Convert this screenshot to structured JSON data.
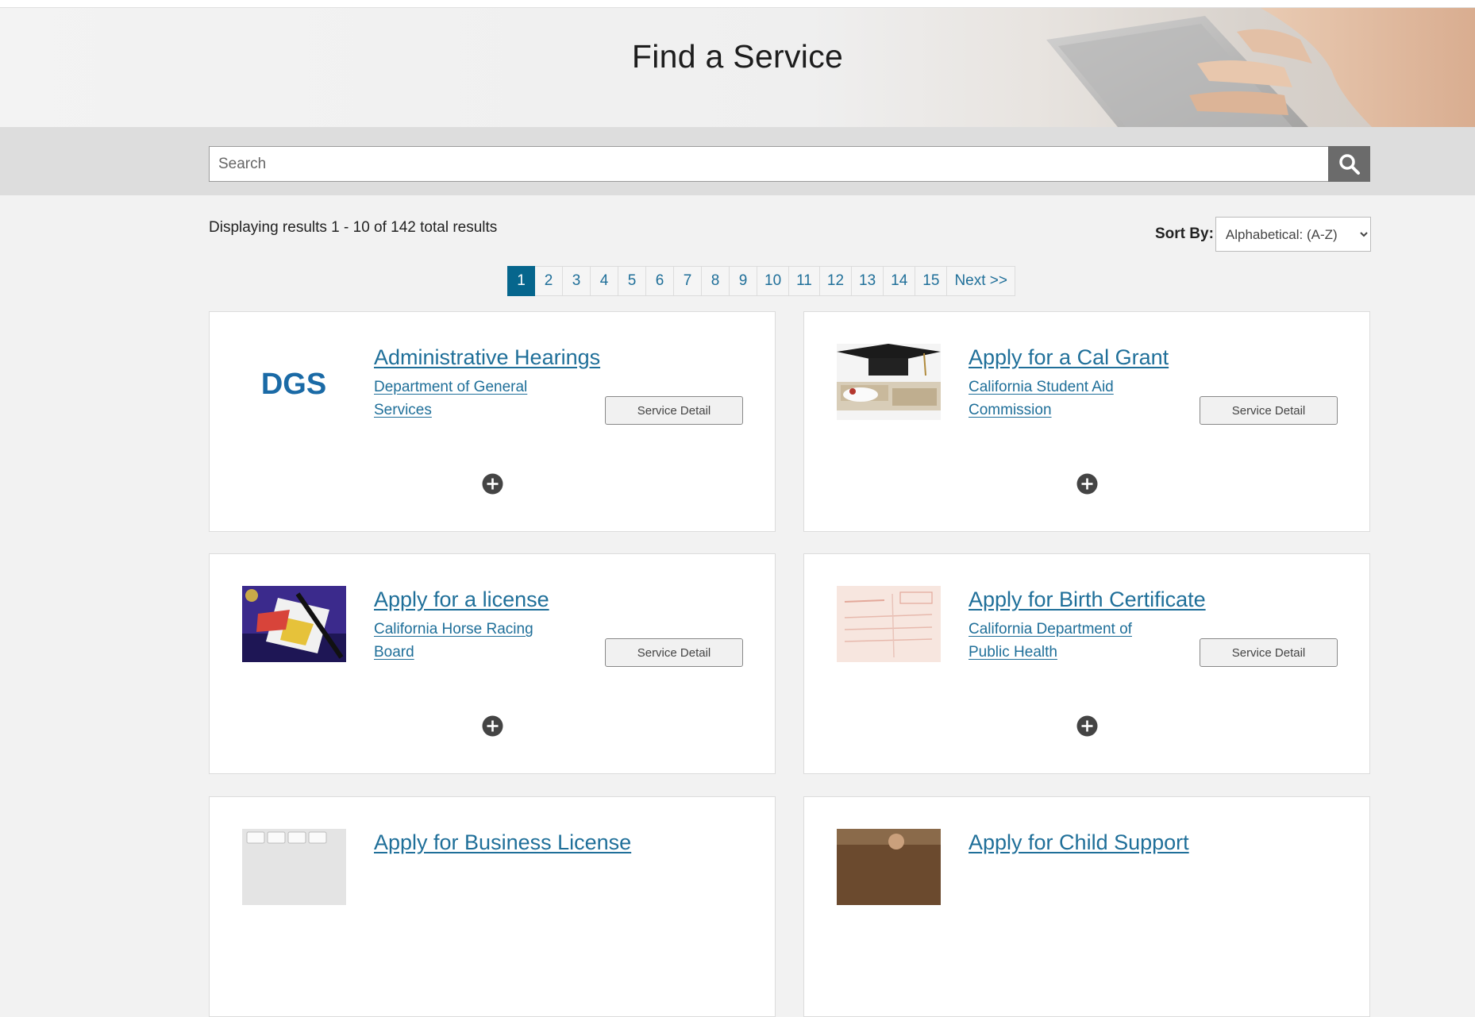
{
  "hero": {
    "title": "Find a Service"
  },
  "search": {
    "placeholder": "Search",
    "button_icon": "magnifier-icon"
  },
  "results": {
    "summary": "Displaying results 1 - 10 of 142 total results"
  },
  "sort": {
    "label": "Sort By:",
    "selected": "Alphabetical: (A-Z)"
  },
  "pagination": {
    "current": "1",
    "pages": [
      "1",
      "2",
      "3",
      "4",
      "5",
      "6",
      "7",
      "8",
      "9",
      "10",
      "11",
      "12",
      "13",
      "14",
      "15"
    ],
    "next": "Next >>"
  },
  "colors": {
    "link": "#1f6f99",
    "active_page": "#06668d",
    "search_button": "#6b6b6b"
  },
  "services": [
    {
      "title": "Administrative Hearings",
      "agency_line1": "Department of General",
      "agency_line2": "Services",
      "button": "Service Detail",
      "logo_text": "DGS"
    },
    {
      "title": "Apply for a Cal Grant",
      "agency_line1": "California Student Aid",
      "agency_line2": "Commission",
      "button": "Service Detail"
    },
    {
      "title": "Apply for a license",
      "agency_line1": "California Horse Racing",
      "agency_line2": "Board",
      "button": "Service Detail"
    },
    {
      "title": "Apply for Birth Certificate",
      "agency_line1": "California Department of",
      "agency_line2": "Public Health",
      "button": "Service Detail"
    },
    {
      "title": "Apply for Business License"
    },
    {
      "title": "Apply for Child Support"
    }
  ]
}
